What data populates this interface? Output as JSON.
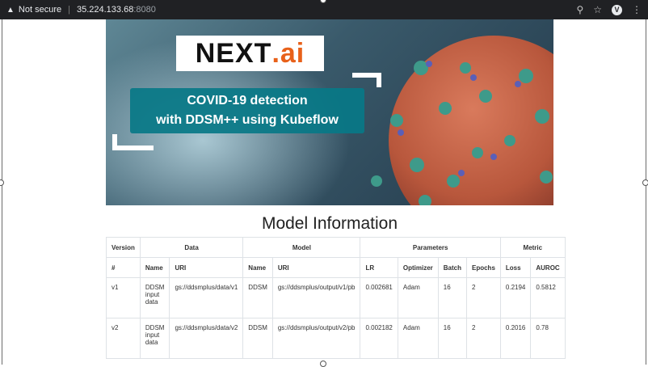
{
  "browser": {
    "security_label": "Not secure",
    "host": "35.224.133.68",
    "port": ":8080"
  },
  "banner": {
    "logo_main": "NEXT",
    "logo_dot": ".",
    "logo_ai": "ai",
    "title_line1": "COVID-19 detection",
    "title_line2": "with DDSM++ using Kubeflow"
  },
  "page": {
    "heading": "Model Information"
  },
  "table": {
    "group_headers": [
      "Version",
      "Data",
      "Model",
      "Parameters",
      "Metric"
    ],
    "sub_headers": [
      "#",
      "Name",
      "URI",
      "Name",
      "URI",
      "LR",
      "Optimizer",
      "Batch",
      "Epochs",
      "Loss",
      "AUROC"
    ],
    "rows": [
      [
        "v1",
        "DDSM input data",
        "gs://ddsmplus/data/v1",
        "DDSM",
        "gs://ddsmplus/output/v1/pb",
        "0.002681",
        "Adam",
        "16",
        "2",
        "0.2194",
        "0.5812"
      ],
      [
        "v2",
        "DDSM input data",
        "gs://ddsmplus/data/v2",
        "DDSM",
        "gs://ddsmplus/output/v2/pb",
        "0.002182",
        "Adam",
        "16",
        "2",
        "0.2016",
        "0.78"
      ]
    ]
  }
}
